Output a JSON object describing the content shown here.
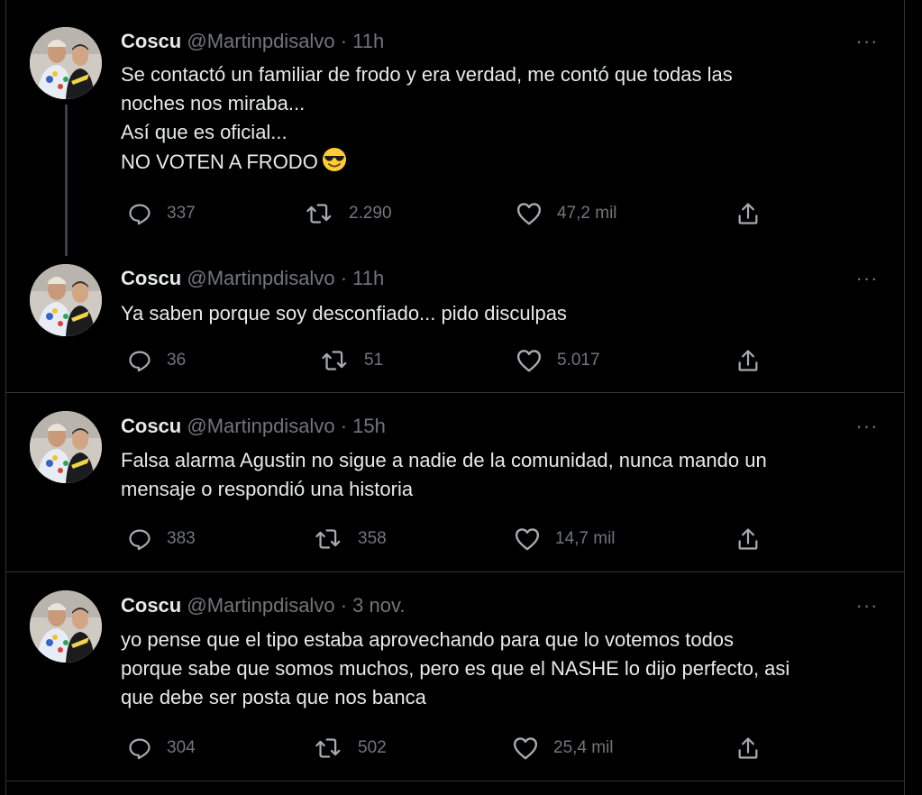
{
  "colors": {
    "background": "#000000",
    "text_primary": "#e7e9ea",
    "text_secondary": "#71767b",
    "border": "#2f3336"
  },
  "icons": {
    "reply": "reply-icon",
    "retweet": "retweet-icon",
    "like": "heart-icon",
    "share": "share-icon",
    "more": "more-icon"
  },
  "tweets": [
    {
      "name": "Coscu",
      "handle": "@Martinpdisalvo",
      "separator": "·",
      "time": "11h",
      "more": "···",
      "lines": [
        "Se contactó un familiar de frodo y era verdad, me contó que todas las",
        "noches nos miraba...",
        "Así que es oficial...",
        "NO VOTEN A FRODO"
      ],
      "emoji": "smiling-face-with-sunglasses",
      "replies": "337",
      "retweets": "2.290",
      "likes": "47,2 mil"
    },
    {
      "name": "Coscu",
      "handle": "@Martinpdisalvo",
      "separator": "·",
      "time": "11h",
      "more": "···",
      "lines": [
        "Ya saben porque soy desconfiado... pido disculpas"
      ],
      "replies": "36",
      "retweets": "51",
      "likes": "5.017"
    },
    {
      "name": "Coscu",
      "handle": "@Martinpdisalvo",
      "separator": "·",
      "time": "15h",
      "more": "···",
      "lines": [
        "Falsa alarma Agustin no sigue a nadie de la comunidad, nunca mando un",
        "mensaje o respondió una historia"
      ],
      "replies": "383",
      "retweets": "358",
      "likes": "14,7 mil"
    },
    {
      "name": "Coscu",
      "handle": "@Martinpdisalvo",
      "separator": "·",
      "time": "3 nov.",
      "more": "···",
      "lines": [
        "yo pense que el tipo estaba aprovechando para que lo votemos todos",
        "porque sabe que somos muchos, pero es que el NASHE lo dijo perfecto, asi",
        "que debe ser posta que nos banca"
      ],
      "replies": "304",
      "retweets": "502",
      "likes": "25,4 mil"
    }
  ]
}
